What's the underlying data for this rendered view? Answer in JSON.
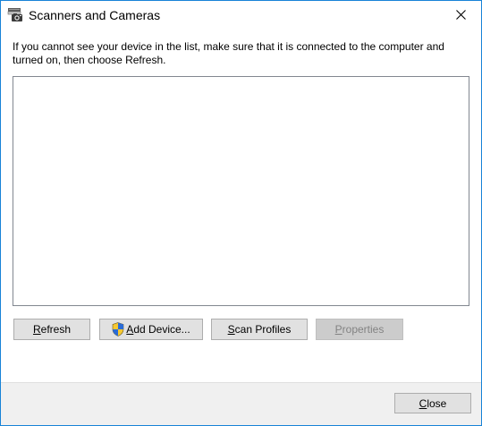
{
  "window": {
    "title": "Scanners and Cameras",
    "title_icon": "scanner-camera-icon",
    "close_icon": "close-icon"
  },
  "instructions": "If you cannot see your device in the list, make sure that it is connected to the computer and turned on, then choose Refresh.",
  "device_list": {
    "items": []
  },
  "buttons": {
    "refresh": {
      "mnemonic": "R",
      "rest": "efresh",
      "enabled": true
    },
    "add_device": {
      "mnemonic": "A",
      "rest": "dd Device...",
      "enabled": true,
      "icon": "uac-shield-icon"
    },
    "scan_profiles": {
      "mnemonic": "S",
      "rest": "can Profiles",
      "enabled": true
    },
    "properties": {
      "mnemonic": "P",
      "rest": "roperties",
      "enabled": false
    }
  },
  "footer": {
    "close": {
      "mnemonic": "C",
      "rest": "lose"
    }
  },
  "colors": {
    "window_border": "#1883d7",
    "button_face": "#e1e1e1",
    "button_border": "#adadad",
    "disabled_face": "#cccccc",
    "disabled_text": "#838383",
    "footer_bg": "#f0f0f0",
    "list_border": "#828790"
  }
}
